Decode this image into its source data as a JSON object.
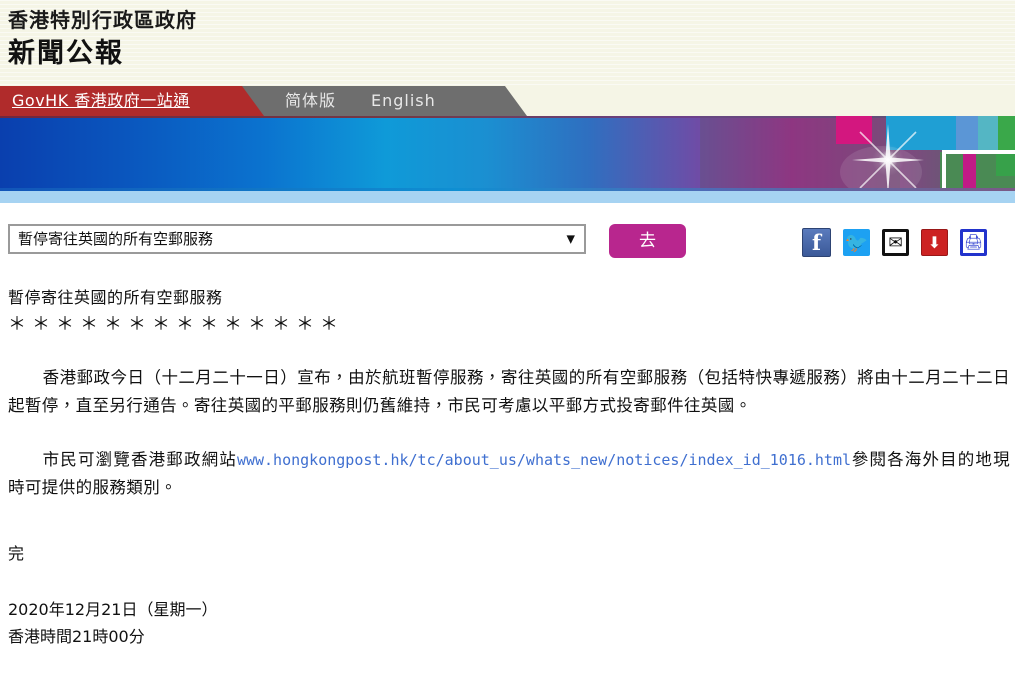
{
  "masthead": {
    "line1": "香港特別行政區政府",
    "line2": "新聞公報"
  },
  "nav": {
    "govhk": "GovHK 香港政府一站通",
    "simplified": "简体版",
    "english": "English",
    "red_color": "#b02b2b",
    "gray_color": "#6e6e6e"
  },
  "banner": {
    "gradient_from": "#0a3fae",
    "gradient_mid": "#0f9ad8",
    "gradient_to": "#a5288f",
    "strip_color": "#a6d3f2"
  },
  "controls": {
    "select_value": "暫停寄往英國的所有空郵服務",
    "select_arrow": "▼",
    "go_label": "去",
    "go_color": "#b8268e"
  },
  "share": {
    "items": [
      {
        "name": "facebook-icon",
        "glyph": "f"
      },
      {
        "name": "twitter-icon",
        "glyph": "🐦"
      },
      {
        "name": "email-icon",
        "glyph": "✉"
      },
      {
        "name": "download-icon",
        "glyph": "⬇"
      },
      {
        "name": "print-icon",
        "glyph": "🖨"
      }
    ]
  },
  "article": {
    "title": "暫停寄往英國的所有空郵服務",
    "stars": "＊＊＊＊＊＊＊＊＊＊＊＊＊＊",
    "para1": "香港郵政今日（十二月二十一日）宣布，由於航班暫停服務，寄往英國的所有空郵服務（包括特快專遞服務）將由十二月二十二日起暫停，直至另行通告。寄往英國的平郵服務則仍舊維持，市民可考慮以平郵方式投寄郵件往英國。",
    "para2_before": "市民可瀏覽香港郵政網站",
    "link": "www.hongkongpost.hk/tc/about_us/whats_new/notices/index_id_1016.html",
    "para2_after": "參閱各海外目的地現時可提供的服務類別。",
    "end": "完",
    "date": "2020年12月21日（星期一）",
    "time": "香港時間21時00分"
  }
}
